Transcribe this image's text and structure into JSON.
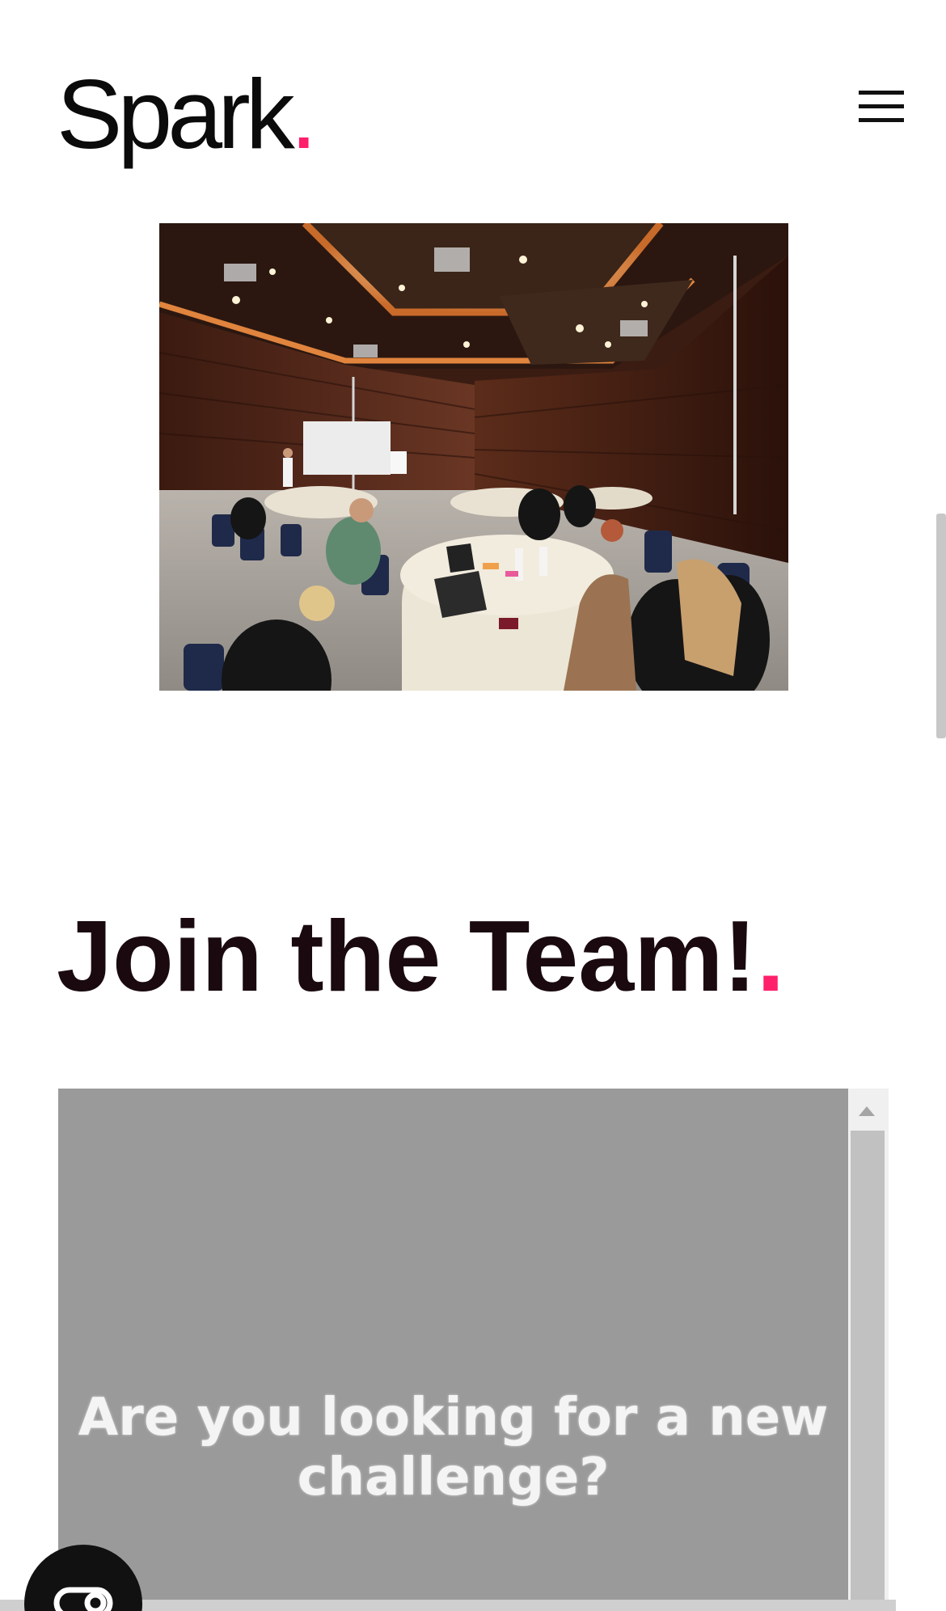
{
  "header": {
    "logo_text": "Spark",
    "logo_dot": ".",
    "menu_icon": "hamburger-menu-icon"
  },
  "hero": {
    "image": "conference-room-event-photo"
  },
  "section": {
    "title": "Join the Team!",
    "title_dot": "."
  },
  "embed": {
    "text": "Are you looking for a new challenge?"
  },
  "fab": {
    "icon": "toggle-icon"
  },
  "colors": {
    "accent": "#ff1f6b",
    "text": "#1a0a0f",
    "embed_background": "#9a9a9a",
    "fab_background": "#111111"
  }
}
